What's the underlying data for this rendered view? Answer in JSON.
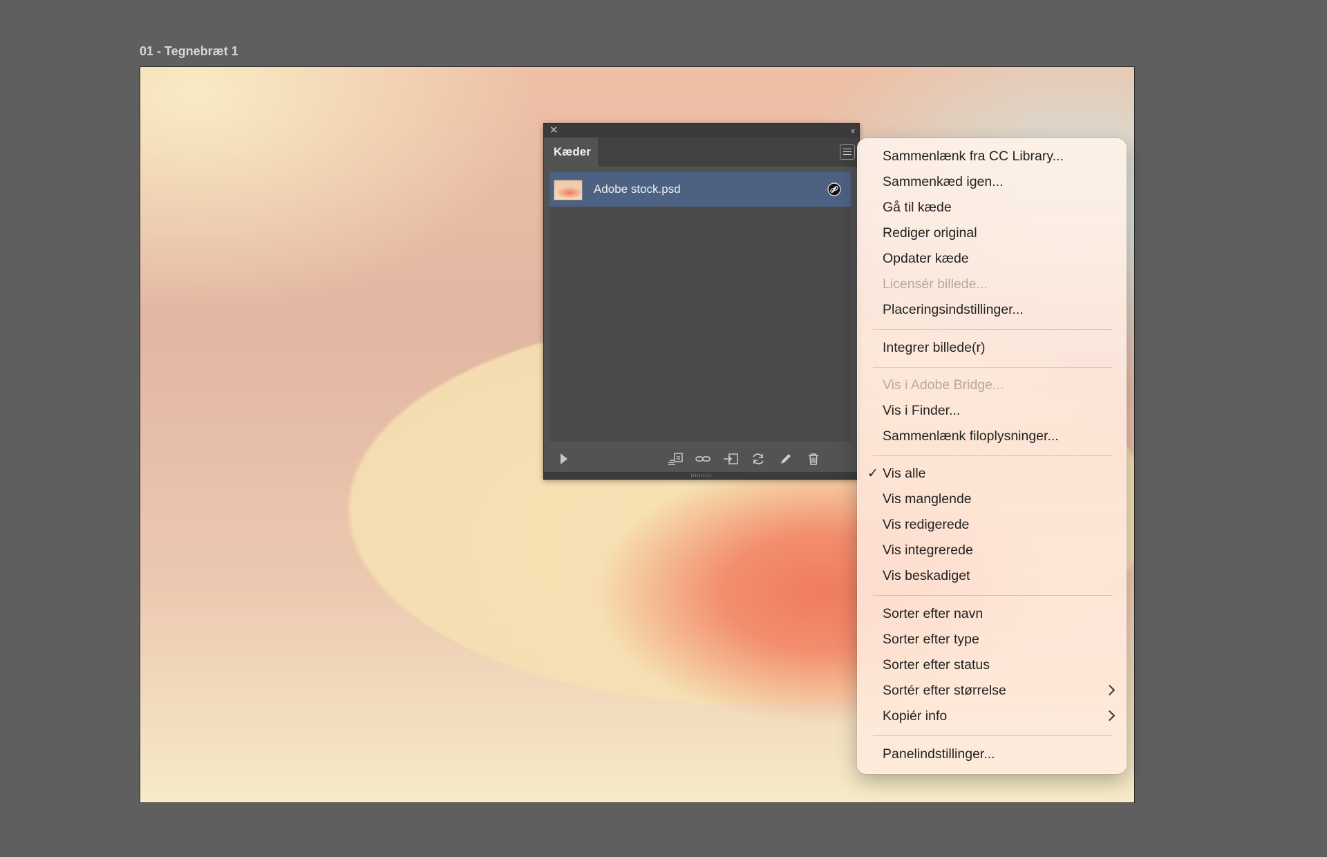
{
  "artboard": {
    "label": "01 - Tegnebræt 1"
  },
  "panel": {
    "close_glyph": "✕",
    "collapse_glyph": "‹‹",
    "tab_label": "Kæder",
    "links": [
      {
        "name": "Adobe stock.psd",
        "icon": "chain-link-icon"
      }
    ],
    "toolbar_icons": [
      "relink-from-cc-library-icon",
      "relink-icon",
      "go-to-link-icon",
      "update-link-icon",
      "edit-original-icon",
      "trash-icon"
    ]
  },
  "menu": {
    "check_glyph": "✓",
    "items": [
      {
        "label": "Sammenlænk fra CC Library..."
      },
      {
        "label": "Sammenkæd igen..."
      },
      {
        "label": "Gå til kæde"
      },
      {
        "label": "Rediger original"
      },
      {
        "label": "Opdater kæde"
      },
      {
        "label": "Licensér billede...",
        "disabled": true
      },
      {
        "label": "Placeringsindstillinger..."
      },
      {
        "label": "Integrer billede(r)"
      },
      {
        "label": "Vis i Adobe Bridge...",
        "disabled": true
      },
      {
        "label": "Vis i Finder..."
      },
      {
        "label": "Sammenlænk filoplysninger..."
      },
      {
        "label": "Vis alle",
        "checked": true
      },
      {
        "label": "Vis manglende"
      },
      {
        "label": "Vis redigerede"
      },
      {
        "label": "Vis integrerede"
      },
      {
        "label": "Vis beskadiget"
      },
      {
        "label": "Sorter efter navn"
      },
      {
        "label": "Sorter efter type"
      },
      {
        "label": "Sorter efter status"
      },
      {
        "label": "Sortér efter størrelse",
        "submenu": true
      },
      {
        "label": "Kopiér info",
        "submenu": true
      },
      {
        "label": "Panelindstillinger..."
      }
    ]
  }
}
